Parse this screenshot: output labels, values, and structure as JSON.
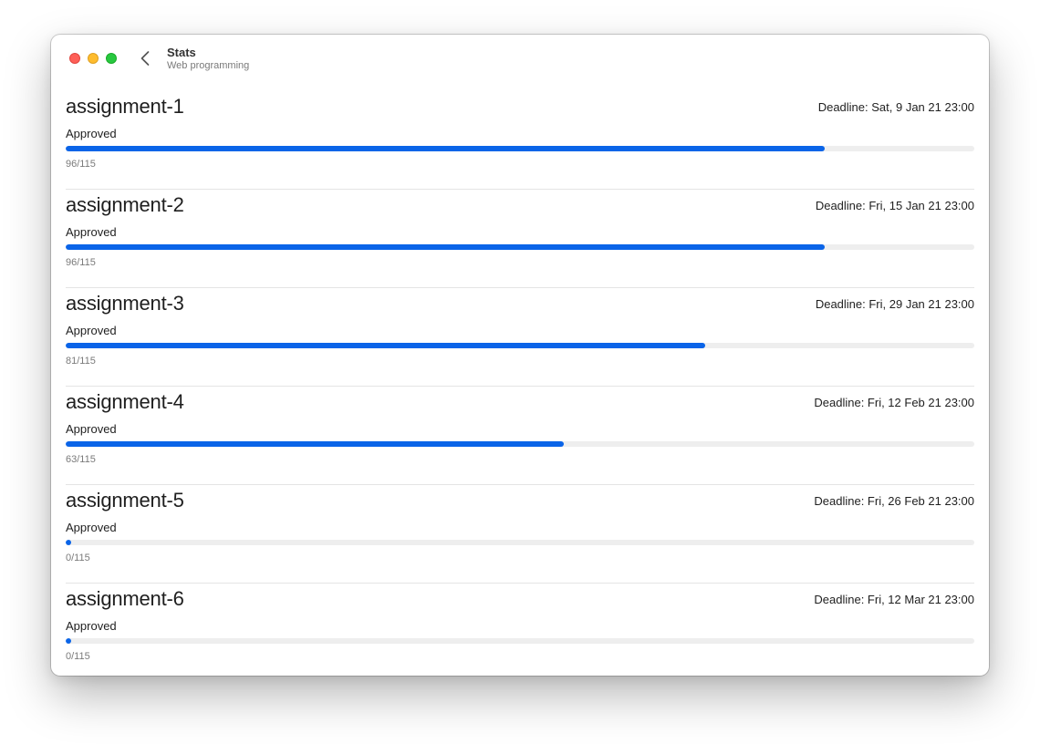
{
  "window": {
    "title": "Stats",
    "subtitle": "Web programming"
  },
  "colors": {
    "accent": "#0a64e8",
    "track": "#eeeeee",
    "close": "#fe5f57",
    "minimize": "#febc2e",
    "zoom": "#28c840"
  },
  "assignments": [
    {
      "name": "assignment-1",
      "deadline": "Deadline: Sat, 9 Jan 21 23:00",
      "status": "Approved",
      "count": "96/115",
      "progress": 0.835
    },
    {
      "name": "assignment-2",
      "deadline": "Deadline: Fri, 15 Jan 21 23:00",
      "status": "Approved",
      "count": "96/115",
      "progress": 0.835
    },
    {
      "name": "assignment-3",
      "deadline": "Deadline: Fri, 29 Jan 21 23:00",
      "status": "Approved",
      "count": "81/115",
      "progress": 0.704
    },
    {
      "name": "assignment-4",
      "deadline": "Deadline: Fri, 12 Feb 21 23:00",
      "status": "Approved",
      "count": "63/115",
      "progress": 0.548
    },
    {
      "name": "assignment-5",
      "deadline": "Deadline: Fri, 26 Feb 21 23:00",
      "status": "Approved",
      "count": "0/115",
      "progress": 0
    },
    {
      "name": "assignment-6",
      "deadline": "Deadline: Fri, 12 Mar 21 23:00",
      "status": "Approved",
      "count": "0/115",
      "progress": 0
    }
  ]
}
